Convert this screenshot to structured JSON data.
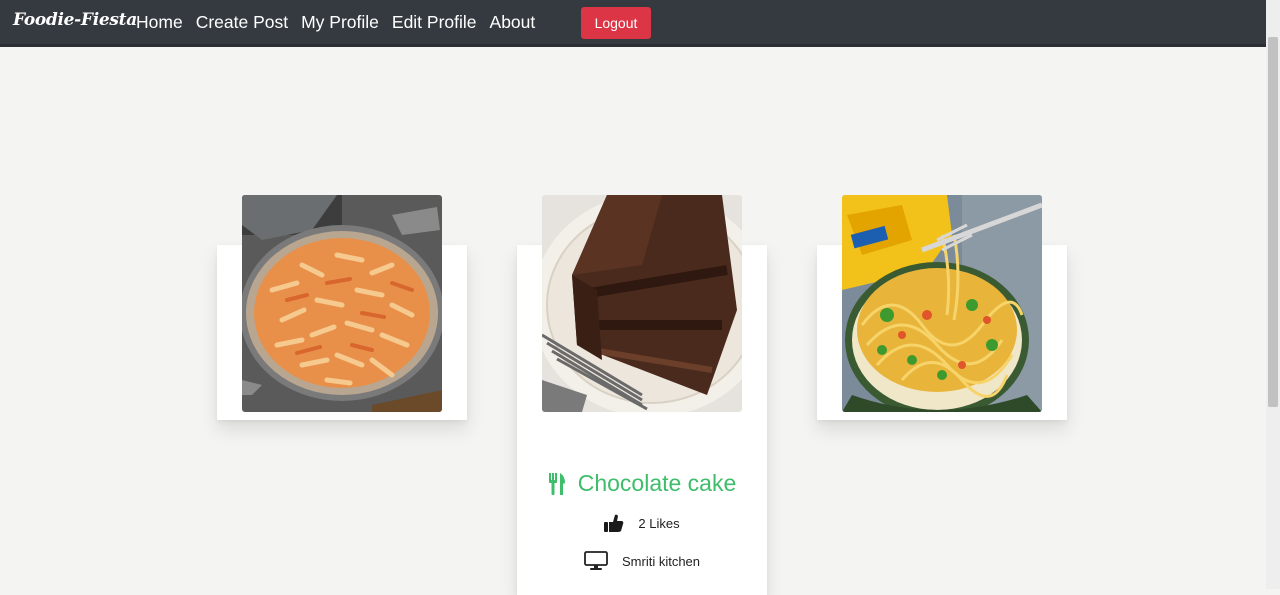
{
  "navbar": {
    "brand": "Foodie-Fiesta",
    "links": [
      "Home",
      "Create Post",
      "My Profile",
      "Edit Profile",
      "About"
    ],
    "logout_label": "Logout"
  },
  "cards": [
    {
      "image": "pasta-image"
    },
    {
      "image": "chocolate-cake-image",
      "title": "Chocolate cake",
      "title_icon": "utensils-icon",
      "likes": "2 Likes",
      "likes_icon": "thumbs-up-icon",
      "channel": "Smriti kitchen",
      "channel_icon": "monitor-icon"
    },
    {
      "image": "noodles-image"
    }
  ],
  "colors": {
    "navbar_bg": "#343a40",
    "logout_bg": "#dc3545",
    "title_green": "#3ebd6a",
    "page_bg": "#f4f5f3"
  }
}
